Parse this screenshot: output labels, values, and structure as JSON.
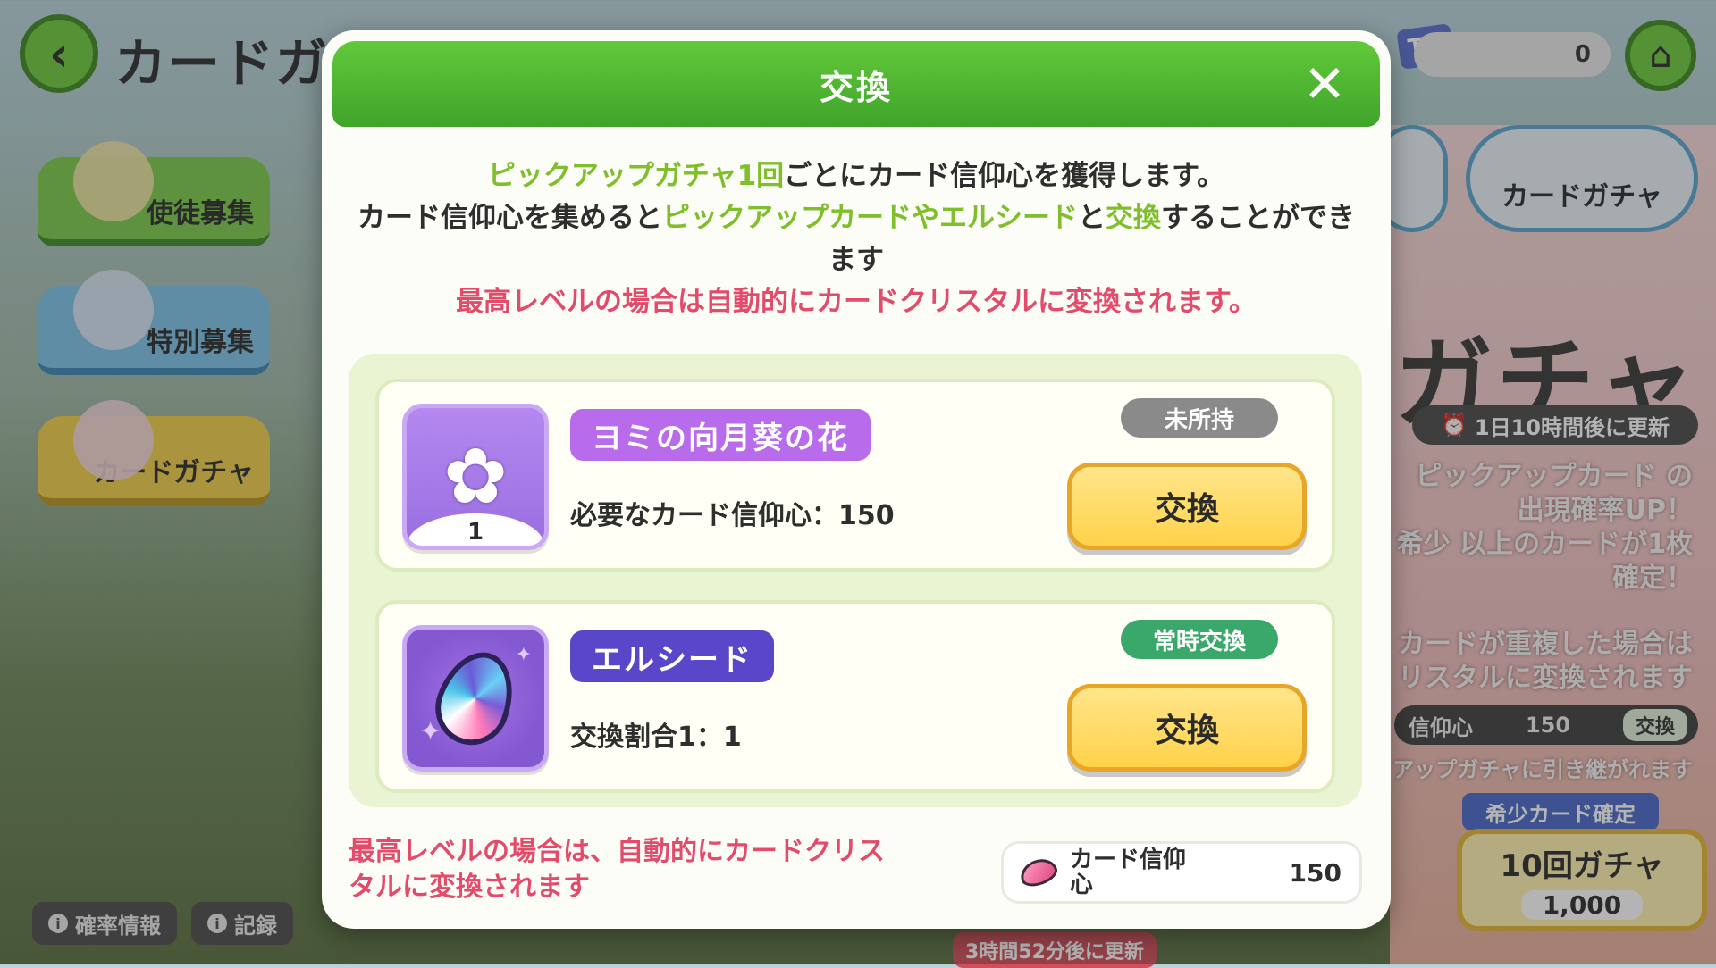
{
  "background": {
    "title": "カードガチ",
    "currency_value": "0",
    "currency_icon_label": "TG",
    "side_tabs": [
      "使徒募集",
      "特別募集",
      "カードガチャ"
    ],
    "right_tab_label": "カードガチャ",
    "big_text": "ガチャ",
    "update_pill": "1日10時間後に更新",
    "right_lines": [
      "ピックアップカード の",
      "出現確率UP！",
      "希少 以上のカードが1枚",
      "確定！",
      "カードが重複した場合は",
      "リスタルに変換されます"
    ],
    "mini_bar": {
      "label": "信仰心",
      "value": "150",
      "button": "交換"
    },
    "carry_note": "アップガチャに引き継がれます",
    "rare_tag": "希少カード確定",
    "ten_gacha": {
      "label": "10回ガチャ",
      "cost": "1,000"
    },
    "bottom_buttons": [
      "確率情報",
      "記録"
    ],
    "bottom_update": "3時間52分後に更新"
  },
  "modal": {
    "title": "交換",
    "close_symbol": "✕",
    "description": {
      "line1_highlight": "ピックアップガチャ1回",
      "line1_rest": "ごとにカード信仰心を獲得します。",
      "line2_a": "カード信仰心を集めると",
      "line2_highlight1": "ピックアップカードやエルシード",
      "line2_b": "と",
      "line2_highlight2": "交換",
      "line2_c": "することができます",
      "warning": "最高レベルの場合は自動的にカードクリスタルに変換されます。"
    },
    "items": [
      {
        "name": "ヨミの向月葵の花",
        "detail": "必要なカード信仰心：150",
        "status": "未所持",
        "button": "交換",
        "quantity": "1",
        "icon": "flower-icon"
      },
      {
        "name": "エルシード",
        "detail": "交換割合1：1",
        "status": "常時交換",
        "button": "交換",
        "icon": "gem-icon"
      }
    ],
    "footer_note": "最高レベルの場合は、自動的にカードクリスタルに変換されます",
    "balance": {
      "label": "カード信仰心",
      "value": "150"
    }
  },
  "colors": {
    "header_green": "#4fb62f",
    "highlight_green": "#7fbf2c",
    "warning_red": "#e24b6a",
    "button_yellow": "#ffd24a",
    "purple_pill": "#b86bea",
    "indigo_pill": "#5a46c8",
    "status_gray": "#8a8a8a",
    "status_green": "#3aa86a"
  }
}
